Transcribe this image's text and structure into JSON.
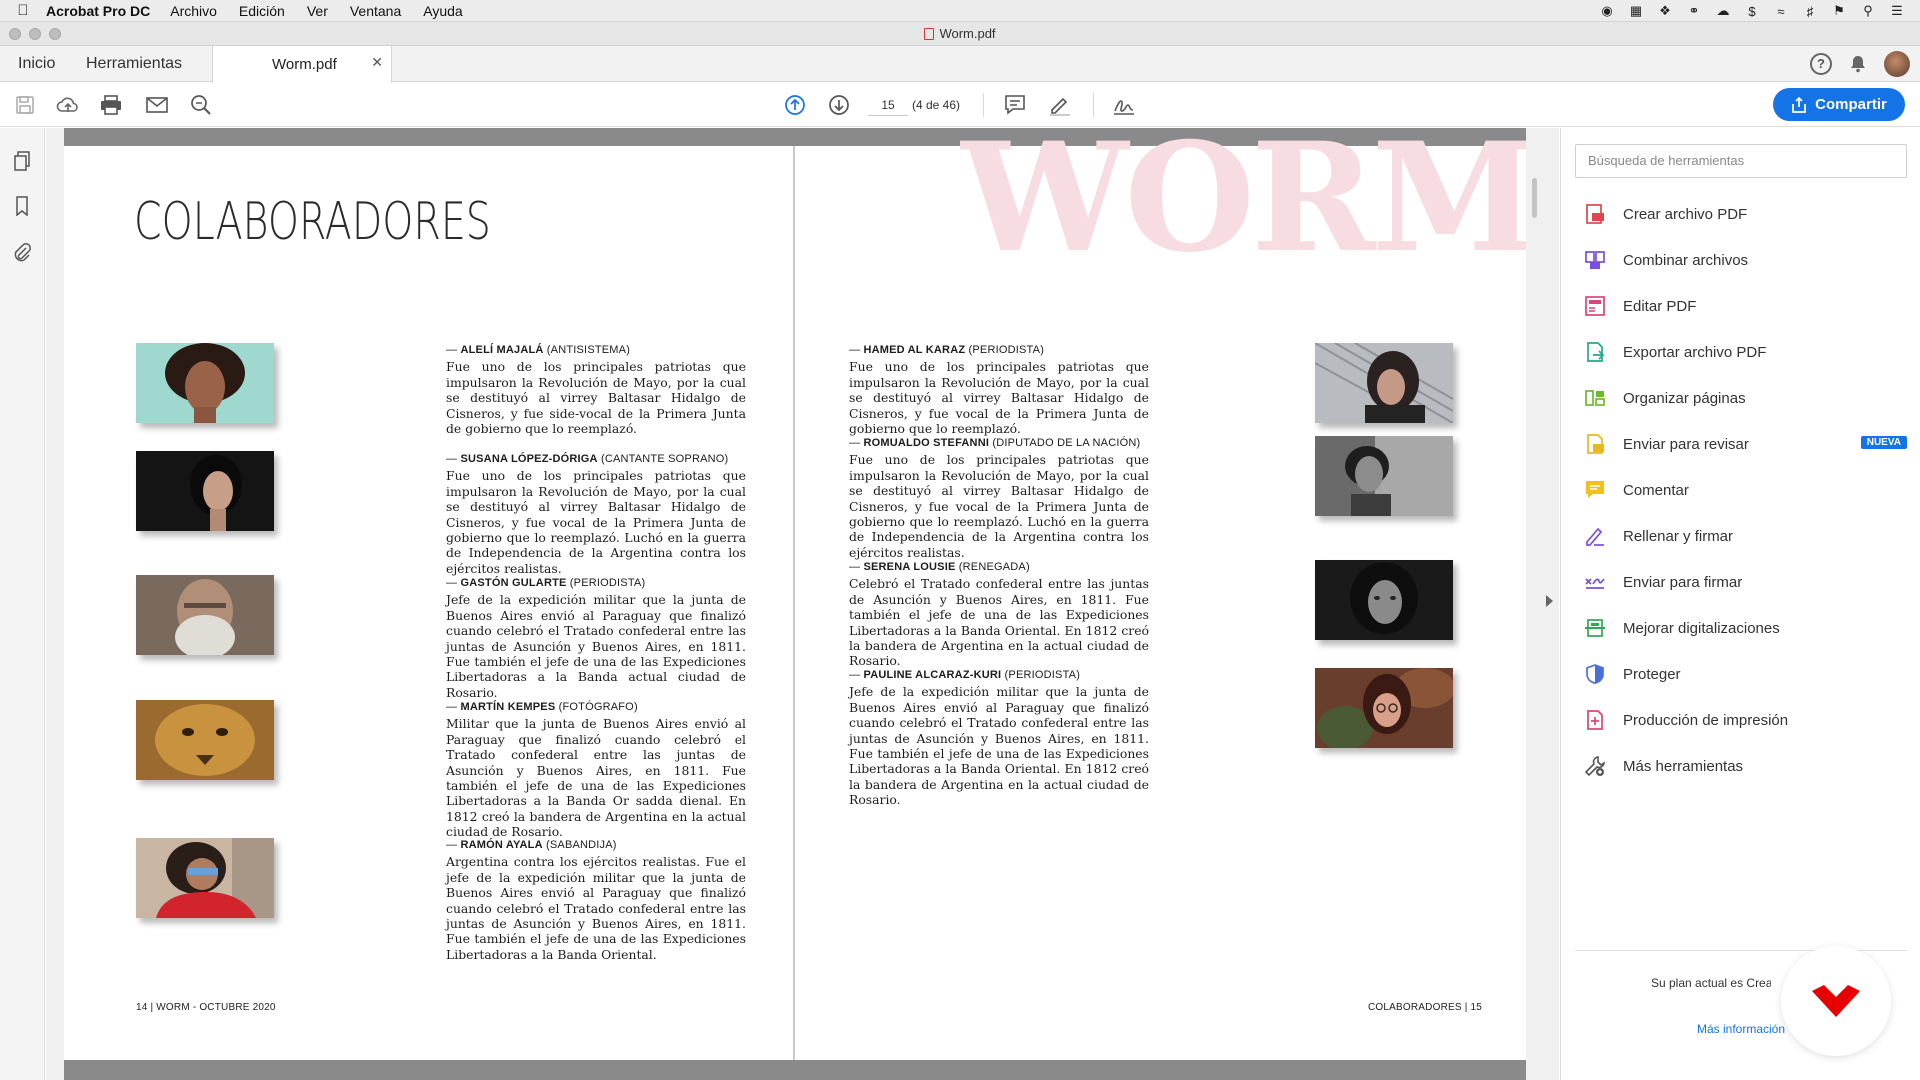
{
  "menubar": {
    "app": "Acrobat Pro DC",
    "items": [
      "Archivo",
      "Edición",
      "Ver",
      "Ventana",
      "Ayuda"
    ]
  },
  "window": {
    "title": "Worm.pdf"
  },
  "tabs": {
    "home": "Inicio",
    "tools": "Herramientas",
    "document": "Worm.pdf"
  },
  "toolbar": {
    "page_number": "15",
    "page_count": "(4 de 46)",
    "share_label": "Compartir"
  },
  "document": {
    "watermark": "WORM",
    "title": "COLABORADORES",
    "left_entries": [
      {
        "dash": "— ",
        "name": "ALELÍ MAJALÁ",
        "role": " (ANTISISTEMA)",
        "text": "Fue uno de los principales patriotas que impulsaron la Revolución de Mayo, por la cual se destituyó al virrey Baltasar Hidalgo de Cisneros, y fue side-vocal de la Primera Junta de gobierno que lo reemplazó."
      },
      {
        "dash": "— ",
        "name": "SUSANA LÓPEZ-DÓRIGA",
        "role": " (CANTANTE SOPRANO)",
        "text": "Fue uno de los principales patriotas que impulsaron la Revolución de Mayo, por la cual se destituyó al virrey Baltasar Hidalgo de Cisneros, y fue vocal de la Primera Junta de gobierno que lo reemplazó. Luchó en la guerra de Independencia de la Argentina contra los ejércitos realistas."
      },
      {
        "dash": "— ",
        "name": "GASTÓN GULARTE",
        "role": " (PERIODISTA)",
        "text": "Jefe de la expedición militar que la junta de Buenos Aires envió al Paraguay que finalizó cuando celebró el Tratado confederal entre las juntas de Asunción y Buenos Aires, en 1811. Fue también el jefe de una de las Expediciones Libertadoras a la Banda actual ciudad de Rosario."
      },
      {
        "dash": "— ",
        "name": "MARTÍN KEMPES",
        "role": " (FOTÓGRAFO)",
        "text": "Militar que la junta de Buenos Aires envió al Paraguay que finalizó cuando celebró el Tratado confederal entre las juntas de Asunción y Buenos Aires, en 1811. Fue también el jefe de una de las Expediciones Libertadoras a la Banda Or sadda dienal. En 1812 creó la bandera de Argentina en la actual ciudad de Rosario."
      },
      {
        "dash": "— ",
        "name": "RAMÓN AYALA",
        "role": " (SABANDIJA)",
        "text": "Argentina contra los ejércitos realistas. Fue el jefe de la expedición militar que la junta de Buenos Aires envió al Paraguay que finalizó cuando celebró el Tratado confederal entre las juntas de Asunción y Buenos Aires, en 1811. Fue también el jefe de una de las Expediciones Libertadoras a la Banda Oriental."
      }
    ],
    "right_entries": [
      {
        "dash": "— ",
        "name": "HAMED AL KARAZ",
        "role": " (PERIODISTA)",
        "text": "Fue uno de los principales patriotas que impulsaron la Revolución de Mayo, por la cual se destituyó al virrey Baltasar Hidalgo de Cisneros, y fue vocal de la Primera Junta de gobierno que lo reemplazó."
      },
      {
        "dash": "— ",
        "name": "ROMUALDO STEFANNI",
        "role": " (DIPUTADO DE LA NACIÓN)",
        "text": "Fue uno de los principales patriotas que impulsaron la Revolución de Mayo, por la cual se destituyó al virrey Baltasar Hidalgo de Cisneros, y fue vocal de la Primera Junta de gobierno que lo reemplazó. Luchó en la guerra de Independencia de la Argentina contra los ejércitos realistas."
      },
      {
        "dash": "— ",
        "name": "SERENA LOUSIE",
        "role": " (RENEGADA)",
        "text": "Celebró el Tratado confederal entre las juntas de Asunción y Buenos Aires, en 1811. Fue también el jefe de una de las Expediciones Libertadoras a la Banda Oriental. En 1812 creó la bandera de Argentina en la actual ciudad de Rosario."
      },
      {
        "dash": "— ",
        "name": "PAULINE ALCARAZ-KURI",
        "role": " (PERIODISTA)",
        "text": "Jefe de la expedición militar que la junta de Buenos Aires envió al Paraguay que finalizó cuando celebró el Tratado confederal entre las juntas de Asunción y Buenos Aires, en 1811. Fue también el jefe de una de las Expediciones Libertadoras a la Banda Oriental. En 1812 creó la bandera de Argentina en la actual ciudad de Rosario."
      }
    ],
    "folio_left": "14 | WORM - OCTUBRE 2020",
    "folio_right": "COLABORADORES | 15"
  },
  "tools_panel": {
    "search_placeholder": "Búsqueda de herramientas",
    "items": [
      {
        "label": "Crear archivo PDF",
        "color": "#e0464c"
      },
      {
        "label": "Combinar archivos",
        "color": "#7a4fd6"
      },
      {
        "label": "Editar PDF",
        "color": "#d9477a"
      },
      {
        "label": "Exportar archivo PDF",
        "color": "#27a88a"
      },
      {
        "label": "Organizar páginas",
        "color": "#6fba2c"
      },
      {
        "label": "Enviar para revisar",
        "color": "#e8b820"
      },
      {
        "label": "Comentar",
        "color": "#f2c21b"
      },
      {
        "label": "Rellenar y firmar",
        "color": "#7a4fd6"
      },
      {
        "label": "Enviar para firmar",
        "color": "#7a4fd6"
      },
      {
        "label": "Mejorar digitalizaciones",
        "color": "#32a852"
      },
      {
        "label": "Proteger",
        "color": "#4a6fd8"
      },
      {
        "label": "Producción de impresión",
        "color": "#d9477a"
      },
      {
        "label": "Más herramientas",
        "color": "#555555"
      }
    ],
    "new_badge": "NUEVA",
    "plan_text": "Su plan actual es Creat",
    "more_info": "Más información"
  },
  "colors": {
    "accent": "#1473e6",
    "brand": "#e60000"
  }
}
